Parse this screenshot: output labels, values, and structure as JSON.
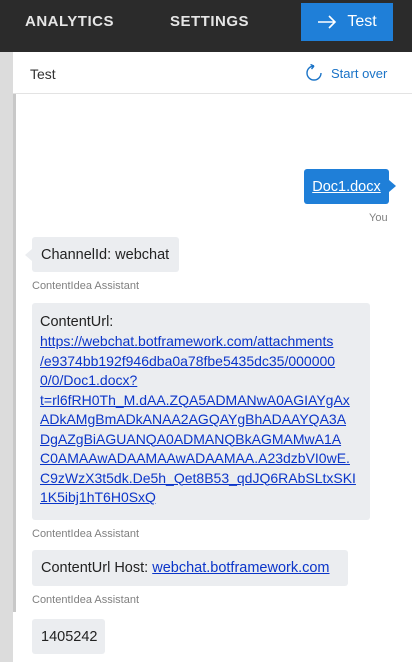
{
  "topbar": {
    "tabs": [
      {
        "label": "ANALYTICS"
      },
      {
        "label": "SETTINGS"
      }
    ],
    "test_label": "Test"
  },
  "panel": {
    "title": "Test",
    "start_over_label": "Start over"
  },
  "chat": {
    "user_message": {
      "link_text": "Doc1.docx",
      "sender": "You"
    },
    "messages": [
      {
        "text": "ChannelId: webchat",
        "sender": "ContentIdea Assistant"
      },
      {
        "label": "ContentUrl:",
        "url_lines": [
          "https://webchat.botframework.com/attachments",
          "/e9374bb192f946dba0a78fbe5435dc35/000000",
          "0/0/Doc1.docx?",
          "t=rl6fRH0Th_M.dAA.ZQA5ADMANwA0AGIAYgAx",
          "ADkAMgBmADkANAA2AGQAYgBhADAAYQA3A",
          "DgAZgBiAGUANQA0ADMANQBkAGMAMwA1A",
          "C0AMAAwADAAMAAwADAAMAA.A23dzbVI0wE.",
          "C9zWzX3t5dk.De5h_Qet8B53_qdJQ6RAbSLtxSKI",
          "1K5ibj1hT6H0SxQ"
        ],
        "sender": "ContentIdea Assistant"
      },
      {
        "label": "ContentUrl Host:",
        "link_text": "webchat.botframework.com",
        "sender": "ContentIdea Assistant"
      },
      {
        "text": "1405242"
      }
    ]
  }
}
